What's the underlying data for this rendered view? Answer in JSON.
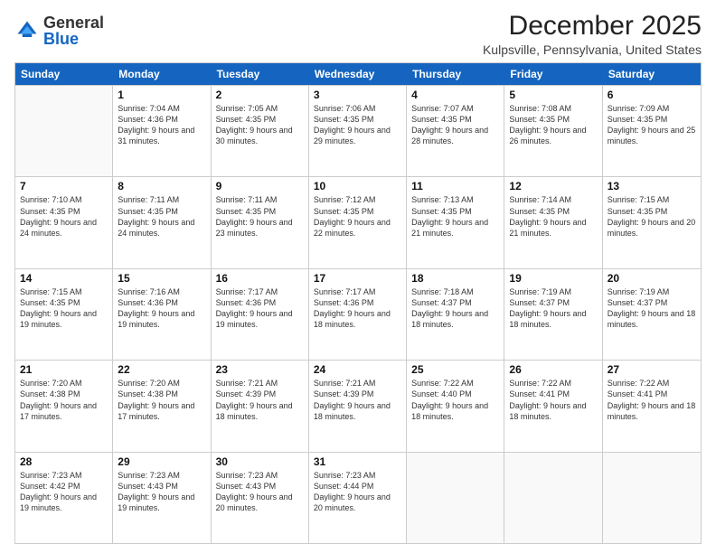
{
  "logo": {
    "general": "General",
    "blue": "Blue"
  },
  "title": "December 2025",
  "subtitle": "Kulpsville, Pennsylvania, United States",
  "days": [
    "Sunday",
    "Monday",
    "Tuesday",
    "Wednesday",
    "Thursday",
    "Friday",
    "Saturday"
  ],
  "weeks": [
    [
      {
        "date": "",
        "sunrise": "",
        "sunset": "",
        "daylight": "",
        "empty": true
      },
      {
        "date": "1",
        "sunrise": "Sunrise: 7:04 AM",
        "sunset": "Sunset: 4:36 PM",
        "daylight": "Daylight: 9 hours and 31 minutes."
      },
      {
        "date": "2",
        "sunrise": "Sunrise: 7:05 AM",
        "sunset": "Sunset: 4:35 PM",
        "daylight": "Daylight: 9 hours and 30 minutes."
      },
      {
        "date": "3",
        "sunrise": "Sunrise: 7:06 AM",
        "sunset": "Sunset: 4:35 PM",
        "daylight": "Daylight: 9 hours and 29 minutes."
      },
      {
        "date": "4",
        "sunrise": "Sunrise: 7:07 AM",
        "sunset": "Sunset: 4:35 PM",
        "daylight": "Daylight: 9 hours and 28 minutes."
      },
      {
        "date": "5",
        "sunrise": "Sunrise: 7:08 AM",
        "sunset": "Sunset: 4:35 PM",
        "daylight": "Daylight: 9 hours and 26 minutes."
      },
      {
        "date": "6",
        "sunrise": "Sunrise: 7:09 AM",
        "sunset": "Sunset: 4:35 PM",
        "daylight": "Daylight: 9 hours and 25 minutes."
      }
    ],
    [
      {
        "date": "7",
        "sunrise": "Sunrise: 7:10 AM",
        "sunset": "Sunset: 4:35 PM",
        "daylight": "Daylight: 9 hours and 24 minutes."
      },
      {
        "date": "8",
        "sunrise": "Sunrise: 7:11 AM",
        "sunset": "Sunset: 4:35 PM",
        "daylight": "Daylight: 9 hours and 24 minutes."
      },
      {
        "date": "9",
        "sunrise": "Sunrise: 7:11 AM",
        "sunset": "Sunset: 4:35 PM",
        "daylight": "Daylight: 9 hours and 23 minutes."
      },
      {
        "date": "10",
        "sunrise": "Sunrise: 7:12 AM",
        "sunset": "Sunset: 4:35 PM",
        "daylight": "Daylight: 9 hours and 22 minutes."
      },
      {
        "date": "11",
        "sunrise": "Sunrise: 7:13 AM",
        "sunset": "Sunset: 4:35 PM",
        "daylight": "Daylight: 9 hours and 21 minutes."
      },
      {
        "date": "12",
        "sunrise": "Sunrise: 7:14 AM",
        "sunset": "Sunset: 4:35 PM",
        "daylight": "Daylight: 9 hours and 21 minutes."
      },
      {
        "date": "13",
        "sunrise": "Sunrise: 7:15 AM",
        "sunset": "Sunset: 4:35 PM",
        "daylight": "Daylight: 9 hours and 20 minutes."
      }
    ],
    [
      {
        "date": "14",
        "sunrise": "Sunrise: 7:15 AM",
        "sunset": "Sunset: 4:35 PM",
        "daylight": "Daylight: 9 hours and 19 minutes."
      },
      {
        "date": "15",
        "sunrise": "Sunrise: 7:16 AM",
        "sunset": "Sunset: 4:36 PM",
        "daylight": "Daylight: 9 hours and 19 minutes."
      },
      {
        "date": "16",
        "sunrise": "Sunrise: 7:17 AM",
        "sunset": "Sunset: 4:36 PM",
        "daylight": "Daylight: 9 hours and 19 minutes."
      },
      {
        "date": "17",
        "sunrise": "Sunrise: 7:17 AM",
        "sunset": "Sunset: 4:36 PM",
        "daylight": "Daylight: 9 hours and 18 minutes."
      },
      {
        "date": "18",
        "sunrise": "Sunrise: 7:18 AM",
        "sunset": "Sunset: 4:37 PM",
        "daylight": "Daylight: 9 hours and 18 minutes."
      },
      {
        "date": "19",
        "sunrise": "Sunrise: 7:19 AM",
        "sunset": "Sunset: 4:37 PM",
        "daylight": "Daylight: 9 hours and 18 minutes."
      },
      {
        "date": "20",
        "sunrise": "Sunrise: 7:19 AM",
        "sunset": "Sunset: 4:37 PM",
        "daylight": "Daylight: 9 hours and 18 minutes."
      }
    ],
    [
      {
        "date": "21",
        "sunrise": "Sunrise: 7:20 AM",
        "sunset": "Sunset: 4:38 PM",
        "daylight": "Daylight: 9 hours and 17 minutes."
      },
      {
        "date": "22",
        "sunrise": "Sunrise: 7:20 AM",
        "sunset": "Sunset: 4:38 PM",
        "daylight": "Daylight: 9 hours and 17 minutes."
      },
      {
        "date": "23",
        "sunrise": "Sunrise: 7:21 AM",
        "sunset": "Sunset: 4:39 PM",
        "daylight": "Daylight: 9 hours and 18 minutes."
      },
      {
        "date": "24",
        "sunrise": "Sunrise: 7:21 AM",
        "sunset": "Sunset: 4:39 PM",
        "daylight": "Daylight: 9 hours and 18 minutes."
      },
      {
        "date": "25",
        "sunrise": "Sunrise: 7:22 AM",
        "sunset": "Sunset: 4:40 PM",
        "daylight": "Daylight: 9 hours and 18 minutes."
      },
      {
        "date": "26",
        "sunrise": "Sunrise: 7:22 AM",
        "sunset": "Sunset: 4:41 PM",
        "daylight": "Daylight: 9 hours and 18 minutes."
      },
      {
        "date": "27",
        "sunrise": "Sunrise: 7:22 AM",
        "sunset": "Sunset: 4:41 PM",
        "daylight": "Daylight: 9 hours and 18 minutes."
      }
    ],
    [
      {
        "date": "28",
        "sunrise": "Sunrise: 7:23 AM",
        "sunset": "Sunset: 4:42 PM",
        "daylight": "Daylight: 9 hours and 19 minutes."
      },
      {
        "date": "29",
        "sunrise": "Sunrise: 7:23 AM",
        "sunset": "Sunset: 4:43 PM",
        "daylight": "Daylight: 9 hours and 19 minutes."
      },
      {
        "date": "30",
        "sunrise": "Sunrise: 7:23 AM",
        "sunset": "Sunset: 4:43 PM",
        "daylight": "Daylight: 9 hours and 20 minutes."
      },
      {
        "date": "31",
        "sunrise": "Sunrise: 7:23 AM",
        "sunset": "Sunset: 4:44 PM",
        "daylight": "Daylight: 9 hours and 20 minutes."
      },
      {
        "date": "",
        "sunrise": "",
        "sunset": "",
        "daylight": "",
        "empty": true
      },
      {
        "date": "",
        "sunrise": "",
        "sunset": "",
        "daylight": "",
        "empty": true
      },
      {
        "date": "",
        "sunrise": "",
        "sunset": "",
        "daylight": "",
        "empty": true
      }
    ]
  ]
}
